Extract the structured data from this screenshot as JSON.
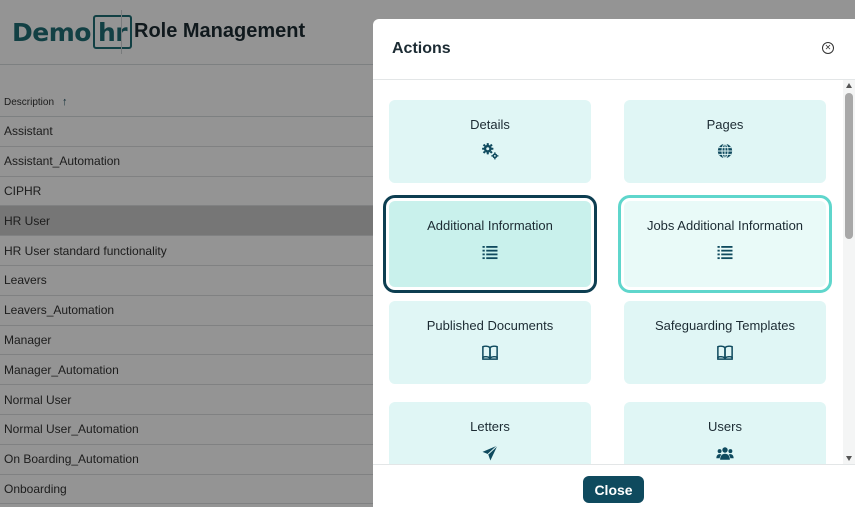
{
  "app": {
    "logo": {
      "part1": "Demo",
      "part2": "hr"
    },
    "page_title": "Role Management"
  },
  "grid": {
    "column_header": "Description",
    "sort_indicator": "ascending",
    "rows": [
      {
        "label": "Assistant",
        "selected": false
      },
      {
        "label": "Assistant_Automation",
        "selected": false
      },
      {
        "label": "CIPHR",
        "selected": false
      },
      {
        "label": "HR User",
        "selected": true
      },
      {
        "label": "HR User standard functionality",
        "selected": false
      },
      {
        "label": "Leavers",
        "selected": false
      },
      {
        "label": "Leavers_Automation",
        "selected": false
      },
      {
        "label": "Manager",
        "selected": false
      },
      {
        "label": "Manager_Automation",
        "selected": false
      },
      {
        "label": "Normal User",
        "selected": false
      },
      {
        "label": "Normal User_Automation",
        "selected": false
      },
      {
        "label": "On Boarding_Automation",
        "selected": false
      },
      {
        "label": "Onboarding",
        "selected": false
      }
    ]
  },
  "modal": {
    "title": "Actions",
    "close_icon": "close-circle-icon",
    "tiles": [
      {
        "label": "Details",
        "icon": "gears-icon"
      },
      {
        "label": "Pages",
        "icon": "globe-icon"
      },
      {
        "label": "Additional Information",
        "icon": "list-icon"
      },
      {
        "label": "Jobs Additional Information",
        "icon": "list-icon"
      },
      {
        "label": "Published Documents",
        "icon": "book-icon"
      },
      {
        "label": "Safeguarding Templates",
        "icon": "book-icon"
      },
      {
        "label": "Letters",
        "icon": "paper-plane-icon"
      },
      {
        "label": "Users",
        "icon": "users-icon"
      }
    ],
    "close_button": "Close"
  },
  "colors": {
    "brand": "#1f6e75",
    "primary_button": "#0f4a5e",
    "tile_bg": "#e0f6f5",
    "focus_dark": "#0d3e51",
    "focus_light": "#5fd6cc",
    "selected_row": "#cbcbcb"
  }
}
